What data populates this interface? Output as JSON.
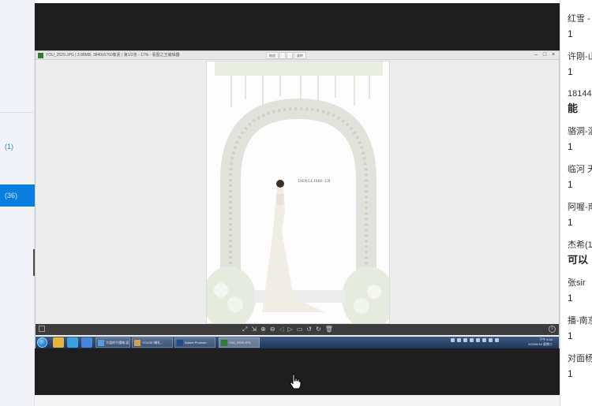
{
  "sidebar": {
    "items": [
      {
        "label": "(1)",
        "active": false
      },
      {
        "label": "(36)",
        "active": true
      }
    ]
  },
  "viewer": {
    "title": "YOU_2529.JPG | 3.88MB, 3840x5760像素 | 第1/2张 - 17% - 看图之王编辑器",
    "toolbar_buttons": [
      "缩放",
      "",
      "",
      "旋转"
    ],
    "window_controls": [
      "–",
      "□",
      "×"
    ],
    "photo_caption": "DENGLISHI·LN",
    "taskbar": {
      "task_buttons": [
        {
          "label": "大道的千禧城·延"
        },
        {
          "label": "YOU2D·婚礼..."
        },
        {
          "label": "Adobe Photosh..."
        },
        {
          "label": "Y0U_2529.JPG"
        }
      ],
      "clock_time": "下午 4:44",
      "clock_date": "2020/6/16 星期二"
    }
  },
  "right_panel": {
    "entries": [
      {
        "name": "红雪 -",
        "count": "1",
        "bold": false
      },
      {
        "name": "许刚-山",
        "count": "1",
        "bold": false
      },
      {
        "name": "18144",
        "count": "能",
        "bold": true
      },
      {
        "name": "骆洞-淄",
        "count": "1",
        "bold": false
      },
      {
        "name": "临河 天",
        "count": "1",
        "bold": false
      },
      {
        "name": "阿喔-南",
        "count": "1",
        "bold": false
      },
      {
        "name": "杰希(1",
        "count": "可以",
        "bold": true
      },
      {
        "name": "张sir",
        "count": "1",
        "bold": false
      },
      {
        "name": "播-南京",
        "count": "1",
        "bold": false
      },
      {
        "name": "对面杨",
        "count": "1",
        "bold": false
      }
    ]
  },
  "colors": {
    "sidebar_active": "#0a7ee0",
    "viewer_dark": "#1e1e1e",
    "taskbar": "#2a4570"
  }
}
